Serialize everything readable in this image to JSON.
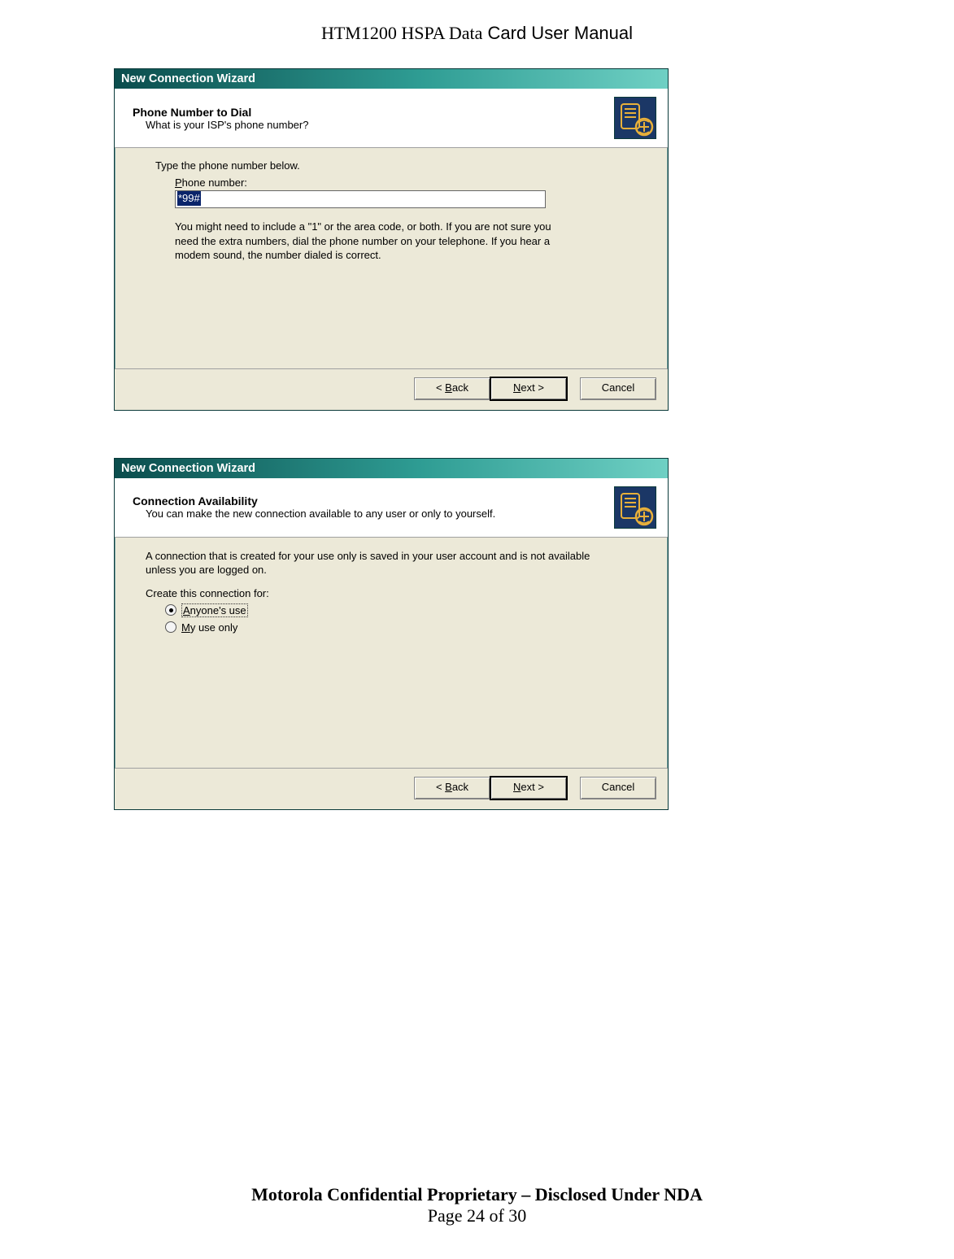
{
  "doc": {
    "header_left": "HTM1200 HSPA Data",
    "header_right": " Card User Manual",
    "footer_bold": "Motorola Confidential Proprietary – Disclosed Under NDA",
    "footer_page": "Page 24 of 30"
  },
  "wiz1": {
    "title": "New Connection Wizard",
    "header_title": "Phone Number to Dial",
    "header_sub": "What is your ISP's phone number?",
    "type_label": "Type the phone number below.",
    "phone_label_u": "P",
    "phone_label_rest": "hone number:",
    "phone_value": "*99#",
    "hint": "You might need to include a \"1\" or the area code, or both. If you are not sure you need the extra numbers, dial the phone number on your telephone. If you hear a modem sound, the number dialed is correct.",
    "back_pre": "< ",
    "back_u": "B",
    "back_post": "ack",
    "next_u": "N",
    "next_post": "ext >",
    "cancel": "Cancel"
  },
  "wiz2": {
    "title": "New Connection Wizard",
    "header_title": "Connection Availability",
    "header_sub": "You can make the new connection available to any user or only to yourself.",
    "intro": "A connection that is created for your use only is saved in your user account and is not available unless you are logged on.",
    "create_label": "Create this connection for:",
    "opt1_u": "A",
    "opt1_rest": "nyone's use",
    "opt2_u": "M",
    "opt2_rest": "y use only",
    "back_pre": "< ",
    "back_u": "B",
    "back_post": "ack",
    "next_u": "N",
    "next_post": "ext >",
    "cancel": "Cancel"
  }
}
